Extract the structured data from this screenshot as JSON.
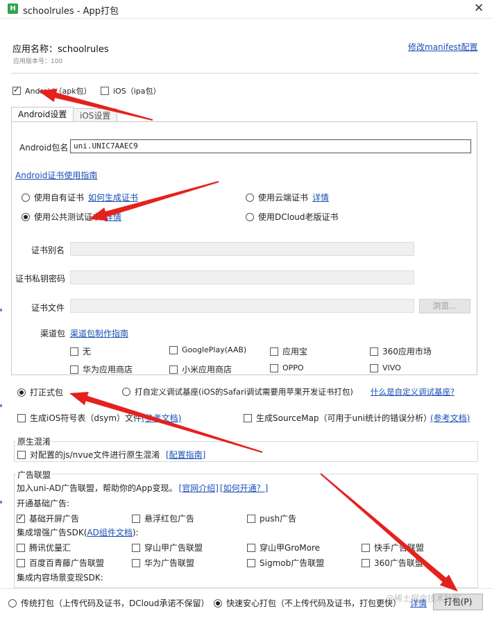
{
  "window": {
    "title": "schoolrules - App打包",
    "icon_letter": "H",
    "close_symbol": "✕"
  },
  "app": {
    "name_line": "应用名称：schoolrules",
    "version_line": "应用版本号：100",
    "manifest_link": "修改manifest配置"
  },
  "platforms": [
    {
      "label": "Android（apk包）",
      "checked": true
    },
    {
      "label": "iOS（ipa包）",
      "checked": false
    }
  ],
  "tabs": [
    {
      "label": "Android设置",
      "active": true
    },
    {
      "label": "iOS设置",
      "active": false
    }
  ],
  "android": {
    "package_label": "Android包名",
    "package_value": "uni.UNIC7AAEC9",
    "cert_guide_link": "Android证书使用指南",
    "cert_options": [
      {
        "label": "使用自有证书",
        "link": "如何生成证书",
        "checked": false
      },
      {
        "label": "使用云端证书",
        "link": "详情",
        "checked": false
      },
      {
        "label": "使用公共测试证书",
        "link": "详情",
        "checked": true
      },
      {
        "label": "使用DCloud老版证书",
        "link": "",
        "checked": false
      }
    ],
    "alias_label": "证书别名",
    "password_label": "证书私钥密码",
    "file_label": "证书文件",
    "browse_label": "浏览...",
    "channel_label": "渠道包",
    "channel_link": "渠道包制作指南",
    "channels": [
      {
        "label": "无",
        "checked": false
      },
      {
        "label": "GooglePlay(AAB)",
        "checked": false
      },
      {
        "label": "应用宝",
        "checked": false
      },
      {
        "label": "360应用市场",
        "checked": false
      },
      {
        "label": "华为应用商店",
        "checked": false
      },
      {
        "label": "小米应用商店",
        "checked": false
      },
      {
        "label": "OPPO",
        "checked": false
      },
      {
        "label": "VIVO",
        "checked": false
      }
    ]
  },
  "build_type": {
    "formal": {
      "label": "打正式包",
      "checked": true
    },
    "custom": {
      "label": "打自定义调试基座(iOS的Safari调试需要用苹果开发证书打包)",
      "checked": false
    },
    "custom_link": "什么是自定义调试基座?"
  },
  "symbols": {
    "ios_dsym": {
      "label": "生成iOS符号表（dsym）文件",
      "checked": false,
      "link": "(参考文档)"
    },
    "sourcemap": {
      "label": "生成SourceMap（可用于uni统计的错误分析）",
      "checked": false,
      "link": "(参考文档)"
    }
  },
  "obfuscation": {
    "title": "原生混淆",
    "option": "对配置的js/nvue文件进行原生混淆",
    "checked": false,
    "link": "[配置指南]"
  },
  "ads": {
    "title": "广告联盟",
    "intro": "加入uni-AD广告联盟，帮助你的App变现。",
    "intro_link1": "[官网介绍]",
    "intro_link2": "[如何开通？]",
    "basic_heading": "开通基础广告:",
    "basic": [
      {
        "label": "基础开屏广告",
        "checked": true
      },
      {
        "label": "悬浮红包广告",
        "checked": false
      },
      {
        "label": "push广告",
        "checked": false
      }
    ],
    "sdk_heading_pre": "集成增强广告SDK(",
    "sdk_heading_link": "AD组件文档",
    "sdk_heading_post": "):",
    "sdk": [
      {
        "label": "腾讯优量汇",
        "checked": false
      },
      {
        "label": "穿山甲广告联盟",
        "checked": false
      },
      {
        "label": "穿山甲GroMore",
        "checked": false
      },
      {
        "label": "快手广告联盟",
        "checked": false
      },
      {
        "label": "百度百青藤广告联盟",
        "checked": false
      },
      {
        "label": "华为广告联盟",
        "checked": false
      },
      {
        "label": "Sigmob广告联盟",
        "checked": false
      },
      {
        "label": "360广告联盟",
        "checked": false
      }
    ],
    "content_heading": "集成内容场景变现SDK:"
  },
  "footer": {
    "traditional": {
      "label": "传统打包（上传代码及证书，DCloud承诺不保留）",
      "checked": false
    },
    "fast": {
      "label": "快速安心打包（不上传代码及证书，打包更快）",
      "checked": true
    },
    "detail_link": "详情",
    "pack_button": "打包(P)",
    "watermark": "@稀土掘金技术社区"
  },
  "colors": {
    "link": "#1b4fb5",
    "arrow": "#e5211d",
    "icon": "#2ea44f"
  }
}
